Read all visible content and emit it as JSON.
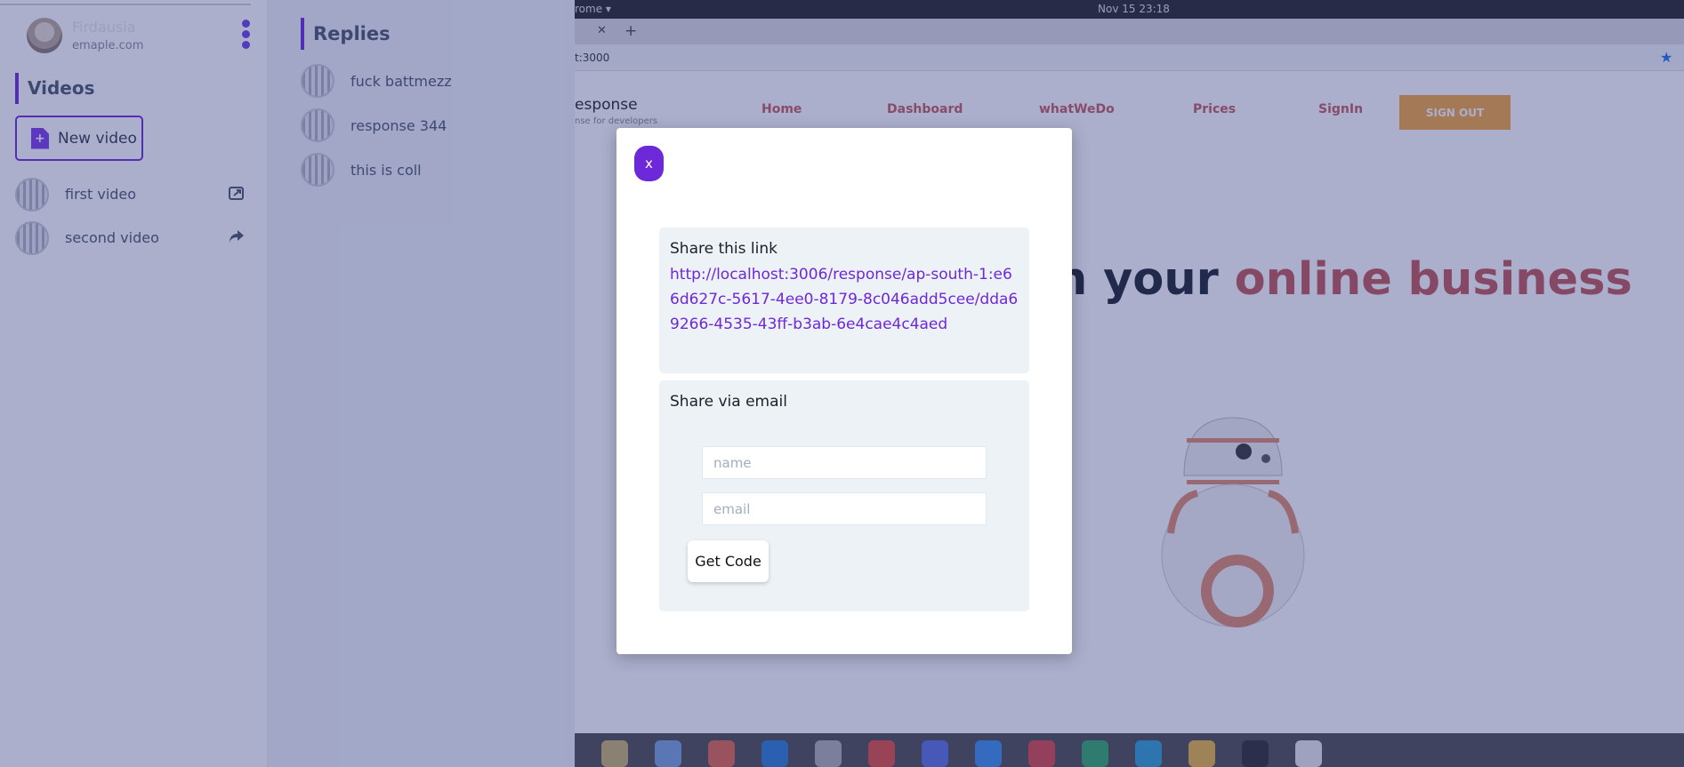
{
  "sidebar": {
    "profile": {
      "name": "Firdausia",
      "email": "emaple.com"
    },
    "section_title": "Videos",
    "new_video_label": "New video",
    "videos": [
      {
        "title": "first video",
        "icon": "share-square-icon"
      },
      {
        "title": "second video",
        "icon": "share-arrow-icon"
      }
    ]
  },
  "replies": {
    "title": "Replies",
    "items": [
      {
        "title": "fuck battmezz"
      },
      {
        "title": "response 344"
      },
      {
        "title": "this is coll"
      }
    ]
  },
  "browser": {
    "os_app": "rome ▾",
    "os_clock": "Nov 15  23:18",
    "tab_close": "✕",
    "tab_new": "+",
    "address": "t:3000",
    "site": {
      "brand": "esponse",
      "tagline": "nse for developers",
      "nav": [
        "Home",
        "Dashboard",
        "whatWeDo",
        "Prices",
        "SignIn"
      ],
      "signout": "SIGN OUT",
      "hero_dark": "n your",
      "hero_accent": "online business"
    }
  },
  "modal": {
    "close_label": "x",
    "share_link_heading": "Share this link",
    "share_link_url": "http://localhost:3006/response/ap-south-1:e66d627c-5617-4ee0-8179-8c046add5cee/dda69266-4535-43ff-b3ab-6e4cae4c4aed",
    "share_email_heading": "Share via email",
    "name_placeholder": "name",
    "email_placeholder": "email",
    "get_code_label": "Get Code"
  },
  "colors": {
    "accent": "#6d28d9",
    "overlay": "#2c3880",
    "signout": "#f3a63b",
    "hero_accent": "#c05656"
  }
}
